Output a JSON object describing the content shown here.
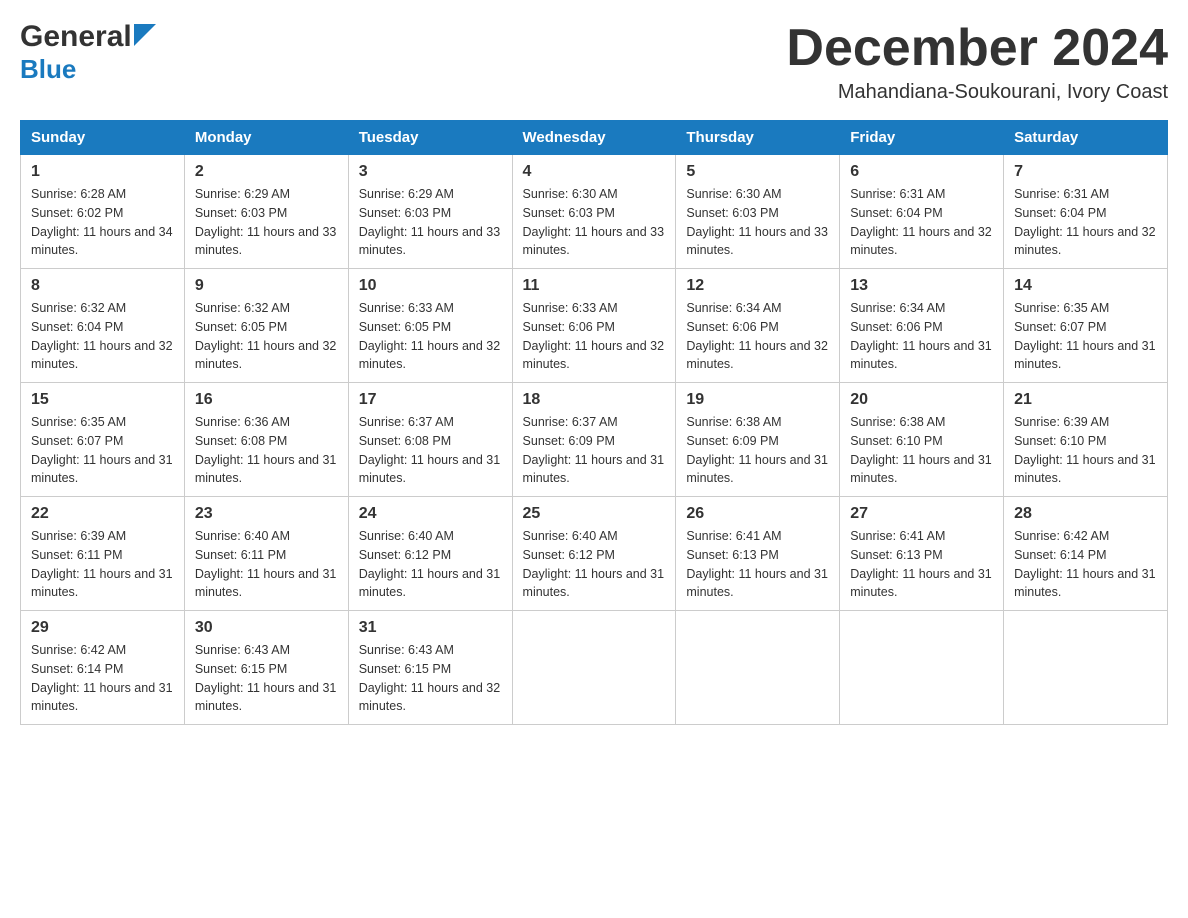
{
  "header": {
    "logo_general": "General",
    "logo_blue": "Blue",
    "main_title": "December 2024",
    "subtitle": "Mahandiana-Soukourani, Ivory Coast"
  },
  "calendar": {
    "days_of_week": [
      "Sunday",
      "Monday",
      "Tuesday",
      "Wednesday",
      "Thursday",
      "Friday",
      "Saturday"
    ],
    "weeks": [
      [
        {
          "date": "1",
          "sunrise": "6:28 AM",
          "sunset": "6:02 PM",
          "daylight": "11 hours and 34 minutes."
        },
        {
          "date": "2",
          "sunrise": "6:29 AM",
          "sunset": "6:03 PM",
          "daylight": "11 hours and 33 minutes."
        },
        {
          "date": "3",
          "sunrise": "6:29 AM",
          "sunset": "6:03 PM",
          "daylight": "11 hours and 33 minutes."
        },
        {
          "date": "4",
          "sunrise": "6:30 AM",
          "sunset": "6:03 PM",
          "daylight": "11 hours and 33 minutes."
        },
        {
          "date": "5",
          "sunrise": "6:30 AM",
          "sunset": "6:03 PM",
          "daylight": "11 hours and 33 minutes."
        },
        {
          "date": "6",
          "sunrise": "6:31 AM",
          "sunset": "6:04 PM",
          "daylight": "11 hours and 32 minutes."
        },
        {
          "date": "7",
          "sunrise": "6:31 AM",
          "sunset": "6:04 PM",
          "daylight": "11 hours and 32 minutes."
        }
      ],
      [
        {
          "date": "8",
          "sunrise": "6:32 AM",
          "sunset": "6:04 PM",
          "daylight": "11 hours and 32 minutes."
        },
        {
          "date": "9",
          "sunrise": "6:32 AM",
          "sunset": "6:05 PM",
          "daylight": "11 hours and 32 minutes."
        },
        {
          "date": "10",
          "sunrise": "6:33 AM",
          "sunset": "6:05 PM",
          "daylight": "11 hours and 32 minutes."
        },
        {
          "date": "11",
          "sunrise": "6:33 AM",
          "sunset": "6:06 PM",
          "daylight": "11 hours and 32 minutes."
        },
        {
          "date": "12",
          "sunrise": "6:34 AM",
          "sunset": "6:06 PM",
          "daylight": "11 hours and 32 minutes."
        },
        {
          "date": "13",
          "sunrise": "6:34 AM",
          "sunset": "6:06 PM",
          "daylight": "11 hours and 31 minutes."
        },
        {
          "date": "14",
          "sunrise": "6:35 AM",
          "sunset": "6:07 PM",
          "daylight": "11 hours and 31 minutes."
        }
      ],
      [
        {
          "date": "15",
          "sunrise": "6:35 AM",
          "sunset": "6:07 PM",
          "daylight": "11 hours and 31 minutes."
        },
        {
          "date": "16",
          "sunrise": "6:36 AM",
          "sunset": "6:08 PM",
          "daylight": "11 hours and 31 minutes."
        },
        {
          "date": "17",
          "sunrise": "6:37 AM",
          "sunset": "6:08 PM",
          "daylight": "11 hours and 31 minutes."
        },
        {
          "date": "18",
          "sunrise": "6:37 AM",
          "sunset": "6:09 PM",
          "daylight": "11 hours and 31 minutes."
        },
        {
          "date": "19",
          "sunrise": "6:38 AM",
          "sunset": "6:09 PM",
          "daylight": "11 hours and 31 minutes."
        },
        {
          "date": "20",
          "sunrise": "6:38 AM",
          "sunset": "6:10 PM",
          "daylight": "11 hours and 31 minutes."
        },
        {
          "date": "21",
          "sunrise": "6:39 AM",
          "sunset": "6:10 PM",
          "daylight": "11 hours and 31 minutes."
        }
      ],
      [
        {
          "date": "22",
          "sunrise": "6:39 AM",
          "sunset": "6:11 PM",
          "daylight": "11 hours and 31 minutes."
        },
        {
          "date": "23",
          "sunrise": "6:40 AM",
          "sunset": "6:11 PM",
          "daylight": "11 hours and 31 minutes."
        },
        {
          "date": "24",
          "sunrise": "6:40 AM",
          "sunset": "6:12 PM",
          "daylight": "11 hours and 31 minutes."
        },
        {
          "date": "25",
          "sunrise": "6:40 AM",
          "sunset": "6:12 PM",
          "daylight": "11 hours and 31 minutes."
        },
        {
          "date": "26",
          "sunrise": "6:41 AM",
          "sunset": "6:13 PM",
          "daylight": "11 hours and 31 minutes."
        },
        {
          "date": "27",
          "sunrise": "6:41 AM",
          "sunset": "6:13 PM",
          "daylight": "11 hours and 31 minutes."
        },
        {
          "date": "28",
          "sunrise": "6:42 AM",
          "sunset": "6:14 PM",
          "daylight": "11 hours and 31 minutes."
        }
      ],
      [
        {
          "date": "29",
          "sunrise": "6:42 AM",
          "sunset": "6:14 PM",
          "daylight": "11 hours and 31 minutes."
        },
        {
          "date": "30",
          "sunrise": "6:43 AM",
          "sunset": "6:15 PM",
          "daylight": "11 hours and 31 minutes."
        },
        {
          "date": "31",
          "sunrise": "6:43 AM",
          "sunset": "6:15 PM",
          "daylight": "11 hours and 32 minutes."
        },
        {
          "date": "",
          "sunrise": "",
          "sunset": "",
          "daylight": ""
        },
        {
          "date": "",
          "sunrise": "",
          "sunset": "",
          "daylight": ""
        },
        {
          "date": "",
          "sunrise": "",
          "sunset": "",
          "daylight": ""
        },
        {
          "date": "",
          "sunrise": "",
          "sunset": "",
          "daylight": ""
        }
      ]
    ]
  }
}
